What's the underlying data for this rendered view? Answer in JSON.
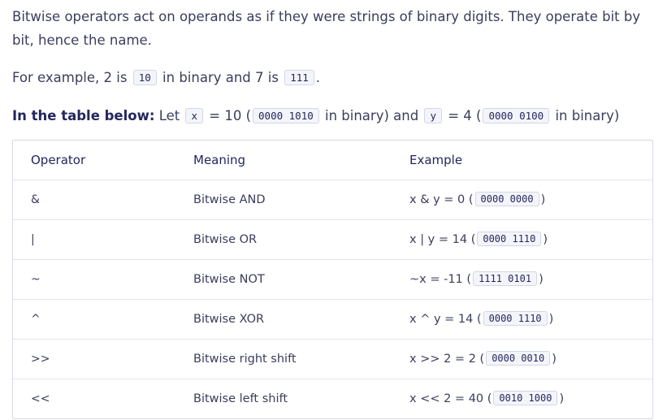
{
  "intro": {
    "line1": "Bitwise operators act on operands as if they were strings of binary digits. They operate bit by bit, hence the name."
  },
  "example": {
    "pre": "For example, 2 is ",
    "code1": "10",
    "mid": " in binary and 7 is ",
    "code2": "111",
    "post": "."
  },
  "table_note": {
    "bold": "In the table below:",
    "t1": " Let ",
    "x_code": "x",
    "t2": " = 10 (",
    "x_bin": "0000 1010",
    "t3": " in binary) and ",
    "y_code": "y",
    "t4": " = 4 (",
    "y_bin": "0000 0100",
    "t5": " in binary)"
  },
  "table": {
    "headers": [
      "Operator",
      "Meaning",
      "Example"
    ],
    "rows": [
      {
        "operator": "&",
        "meaning": "Bitwise AND",
        "example_pre": "x & y = 0 (",
        "example_code": "0000 0000",
        "example_post": ")"
      },
      {
        "operator": "|",
        "meaning": "Bitwise OR",
        "example_pre": "x | y = 14 (",
        "example_code": "0000 1110",
        "example_post": ")"
      },
      {
        "operator": "~",
        "meaning": "Bitwise NOT",
        "example_pre": "~x = -11 (",
        "example_code": "1111 0101",
        "example_post": ")"
      },
      {
        "operator": "^",
        "meaning": "Bitwise XOR",
        "example_pre": "x ^ y = 14 (",
        "example_code": "0000 1110",
        "example_post": ")"
      },
      {
        "operator": ">>",
        "meaning": "Bitwise right shift",
        "example_pre": "x >> 2 = 2 (",
        "example_code": "0000 0010",
        "example_post": ")"
      },
      {
        "operator": "<<",
        "meaning": "Bitwise left shift",
        "example_pre": "x << 2 = 40 (",
        "example_code": "0010 1000",
        "example_post": ")"
      }
    ]
  }
}
